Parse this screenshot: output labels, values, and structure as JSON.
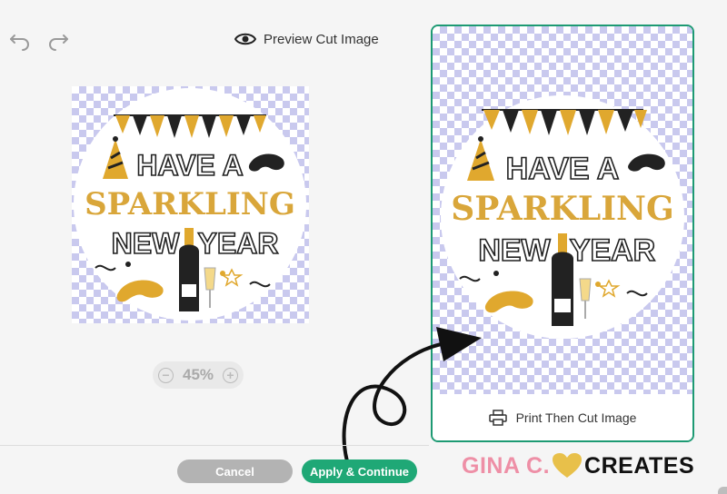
{
  "toolbar": {
    "undo_icon": "undo-icon",
    "redo_icon": "redo-icon",
    "preview_icon": "eye-icon",
    "preview_label": "Preview Cut Image"
  },
  "sticker": {
    "line1": "HAVE A",
    "line2": "SPARKLING",
    "line3a": "NEW",
    "line3b": "YEAR"
  },
  "zoom": {
    "value": "45%",
    "minus_icon": "minus-icon",
    "plus_icon": "plus-icon"
  },
  "card": {
    "option_label": "Print Then Cut Image",
    "option_icon": "printer-icon"
  },
  "actions": {
    "cancel_label": "Cancel",
    "apply_label": "Apply & Continue"
  },
  "branding": {
    "part1": "GINA C.",
    "part2": "CREATES"
  },
  "colors": {
    "accent": "#1fa876",
    "gold": "#e0a82e",
    "checker": "#c9c9ee"
  }
}
